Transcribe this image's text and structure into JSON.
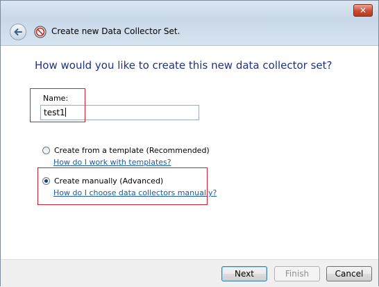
{
  "window": {
    "title": "Create new Data Collector Set.",
    "close_label": "✕"
  },
  "page": {
    "heading": "How would you like to create this new data collector set?"
  },
  "name_field": {
    "label": "Name:",
    "value": "test1"
  },
  "options": {
    "template": {
      "label": "Create from a template (Recommended)",
      "link": "How do I work with templates?",
      "selected": false
    },
    "manual": {
      "label": "Create manually (Advanced)",
      "link": "How do I choose data collectors manually?",
      "selected": true
    }
  },
  "buttons": {
    "next": "Next",
    "finish": "Finish",
    "cancel": "Cancel"
  },
  "colors": {
    "heading": "#1e3287",
    "link": "#1a5aa8",
    "highlight_box": "#d21f2b"
  },
  "icons": {
    "back": "back-arrow-icon",
    "app": "performance-monitor-icon",
    "close": "close-icon"
  }
}
